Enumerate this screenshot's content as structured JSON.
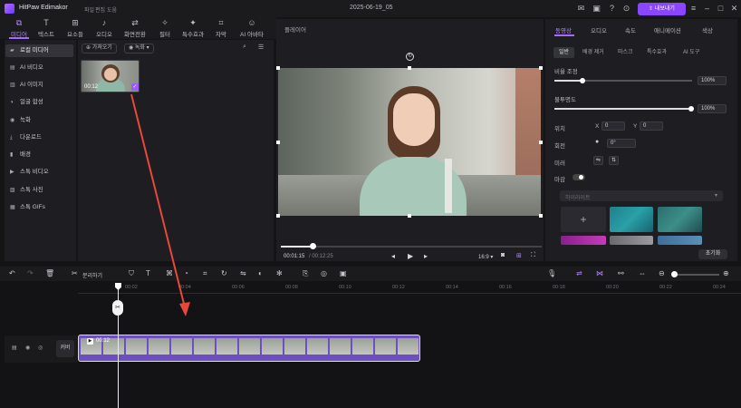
{
  "titlebar": {
    "app_title": "HitPaw Edimakor",
    "menus": [
      "파일",
      "편집",
      "도움"
    ],
    "project_title": "2025-06-19_05",
    "export_label": "내보내기"
  },
  "toolbar": {
    "tools": [
      {
        "icon": "media-icon",
        "label": "미디어"
      },
      {
        "icon": "text-icon",
        "label": "텍스트"
      },
      {
        "icon": "elements-icon",
        "label": "요소들"
      },
      {
        "icon": "audio-icon",
        "label": "오디오"
      },
      {
        "icon": "transition-icon",
        "label": "화면전환"
      },
      {
        "icon": "filter-icon",
        "label": "필터"
      },
      {
        "icon": "effects-icon",
        "label": "특수효과"
      },
      {
        "icon": "subtitle-icon",
        "label": "자막"
      },
      {
        "icon": "ai-avatar-icon",
        "label": "AI 아바타"
      }
    ]
  },
  "sidebar": {
    "items": [
      {
        "label": "로컬 미디어",
        "active": true
      },
      {
        "label": "AI 비디오"
      },
      {
        "label": "AI 이미지"
      },
      {
        "label": "얼굴 합성"
      },
      {
        "label": "녹화"
      },
      {
        "label": "다운로드"
      },
      {
        "label": "배경"
      },
      {
        "label": "스톡 비디오"
      },
      {
        "label": "스톡 사진"
      },
      {
        "label": "스톡 GIFs"
      }
    ]
  },
  "media": {
    "import_label": "가져오기",
    "record_label": "녹화",
    "thumb_duration": "00:12"
  },
  "preview": {
    "label": "플레이어",
    "time_current": "00:01:15",
    "time_total": "/ 00:12:25",
    "ratio": "16:9",
    "progress": 0.1
  },
  "props": {
    "tabs": [
      "동영상",
      "오디오",
      "속도",
      "애니메이션",
      "색상"
    ],
    "subtabs": [
      "일반",
      "배경 제거",
      "마스크",
      "특수효과",
      "AI 도구"
    ],
    "scale_label": "비율 조정",
    "scale_value": "100%",
    "opacity_label": "불투명도",
    "opacity_value": "100%",
    "position_label": "위치",
    "pos_x_label": "X",
    "pos_x": "0",
    "pos_y_label": "Y",
    "pos_y": "0",
    "rotate_label": "회전",
    "rotate_value": "0°",
    "mirror_label": "미러",
    "mask_label": "마감",
    "mask_dropdown": "하이라이트",
    "reset_label": "초기화"
  },
  "timeline": {
    "split_label": "분리하기",
    "ruler": [
      "00:02",
      "00:04",
      "00:06",
      "00:08",
      "00:10",
      "00:12",
      "00:14",
      "00:16",
      "00:18",
      "00:20",
      "00:22",
      "00:24"
    ],
    "cover_label": "커버",
    "clip_duration": "00:12"
  },
  "colors": {
    "accent": "#8a45ff",
    "clip": "#6c4fc0",
    "arrow": "#e8483a"
  }
}
